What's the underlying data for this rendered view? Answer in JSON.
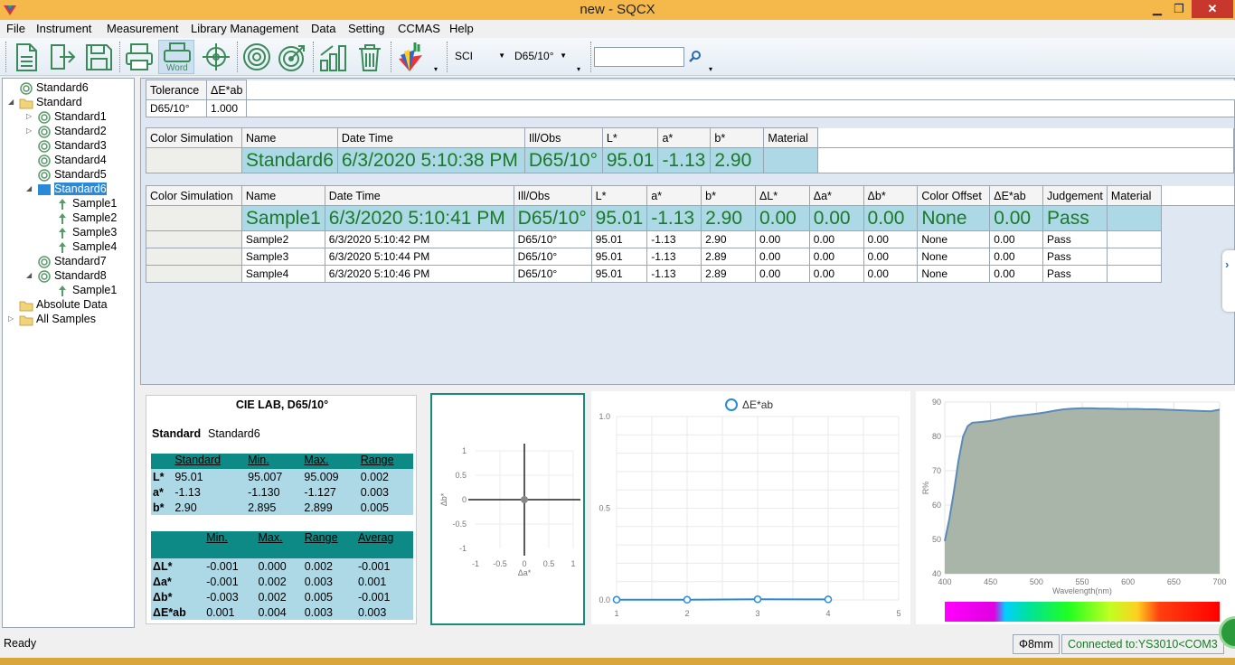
{
  "window": {
    "title": "new - SQCX",
    "minimize": "▁",
    "restore": "❐",
    "close": "✕"
  },
  "menu": [
    "File",
    "Instrument",
    "Measurement",
    "Library Management",
    "Data",
    "Setting",
    "CCMAS",
    "Help"
  ],
  "toolbar": {
    "word_label": "Word",
    "mode": "SCI",
    "illuminant": "D65/10°",
    "search_value": ""
  },
  "tree": {
    "items": [
      {
        "label": "Standard6"
      },
      {
        "label": "Standard"
      },
      {
        "label": "Standard1"
      },
      {
        "label": "Standard2"
      },
      {
        "label": "Standard3"
      },
      {
        "label": "Standard4"
      },
      {
        "label": "Standard5"
      },
      {
        "label": "Standard6"
      },
      {
        "label": "Sample1"
      },
      {
        "label": "Sample2"
      },
      {
        "label": "Sample3"
      },
      {
        "label": "Sample4"
      },
      {
        "label": "Standard7"
      },
      {
        "label": "Standard8"
      },
      {
        "label": "Sample1"
      },
      {
        "label": "Absolute Data"
      },
      {
        "label": "All Samples"
      }
    ]
  },
  "tolerance": {
    "headers": [
      "Tolerance",
      "ΔE*ab"
    ],
    "row": [
      "D65/10°",
      "1.000"
    ]
  },
  "standard_table": {
    "headers": [
      "Color Simulation",
      "Name",
      "Date Time",
      "Ill/Obs",
      "L*",
      "a*",
      "b*",
      "Material"
    ],
    "row": [
      "",
      "Standard6",
      "6/3/2020 5:10:38 PM",
      "D65/10°",
      "95.01",
      "-1.13",
      "2.90",
      ""
    ]
  },
  "sample_table": {
    "headers": [
      "Color Simulation",
      "Name",
      "Date Time",
      "Ill/Obs",
      "L*",
      "a*",
      "b*",
      "ΔL*",
      "Δa*",
      "Δb*",
      "Color Offset",
      "ΔE*ab",
      "Judgement",
      "Material"
    ],
    "rows": [
      [
        "",
        "Sample1",
        "6/3/2020 5:10:41 PM",
        "D65/10°",
        "95.01",
        "-1.13",
        "2.90",
        "0.00",
        "0.00",
        "0.00",
        "None",
        "0.00",
        "Pass",
        ""
      ],
      [
        "",
        "Sample2",
        "6/3/2020 5:10:42 PM",
        "D65/10°",
        "95.01",
        "-1.13",
        "2.90",
        "0.00",
        "0.00",
        "0.00",
        "None",
        "0.00",
        "Pass",
        ""
      ],
      [
        "",
        "Sample3",
        "6/3/2020 5:10:44 PM",
        "D65/10°",
        "95.01",
        "-1.13",
        "2.89",
        "0.00",
        "0.00",
        "0.00",
        "None",
        "0.00",
        "Pass",
        ""
      ],
      [
        "",
        "Sample4",
        "6/3/2020 5:10:46 PM",
        "D65/10°",
        "95.01",
        "-1.13",
        "2.89",
        "0.00",
        "0.00",
        "0.00",
        "None",
        "0.00",
        "Pass",
        ""
      ]
    ]
  },
  "lab_panel": {
    "title": "CIE LAB, D65/10°",
    "standard_label": "Standard",
    "standard_value": "Standard6",
    "t1_headers": [
      "",
      "Standard",
      "Min.",
      "Max.",
      "Range"
    ],
    "t1_rows": [
      [
        "L*",
        "95.01",
        "95.007",
        "95.009",
        "0.002"
      ],
      [
        "a*",
        "-1.13",
        "-1.130",
        "-1.127",
        "0.003"
      ],
      [
        "b*",
        "2.90",
        "2.895",
        "2.899",
        "0.005"
      ]
    ],
    "t2_headers": [
      "",
      "Min.",
      "Max.",
      "Range",
      "Averag"
    ],
    "t2_rows": [
      [
        "ΔL*",
        "-0.001",
        "0.000",
        "0.002",
        "-0.001"
      ],
      [
        "Δa*",
        "-0.001",
        "0.002",
        "0.003",
        "0.001"
      ],
      [
        "Δb*",
        "-0.003",
        "0.002",
        "0.005",
        "-0.001"
      ],
      [
        "ΔE*ab",
        "0.001",
        "0.004",
        "0.003",
        "0.003"
      ]
    ]
  },
  "chart_data": [
    {
      "type": "scatter",
      "xlabel": "Δa*",
      "ylabel": "Δb*",
      "xlim": [
        -1,
        1
      ],
      "ylim": [
        -1,
        1
      ],
      "x_ticks": [
        "-1",
        "-0.5",
        "0",
        "0.5",
        "1"
      ],
      "y_ticks": [
        "1",
        "0.5",
        "0",
        "-0.5",
        "-1"
      ],
      "points": [
        {
          "x": 0,
          "y": 0
        }
      ]
    },
    {
      "type": "line",
      "legend": "ΔE*ab",
      "x": [
        1,
        2,
        3,
        4
      ],
      "values": [
        0.001,
        0.001,
        0.004,
        0.003
      ],
      "xlim": [
        1,
        5
      ],
      "ylim": [
        0,
        1
      ],
      "x_ticks": [
        "1",
        "2",
        "3",
        "4",
        "5"
      ],
      "y_ticks": [
        "1.0",
        "0.5",
        "0.0"
      ],
      "grid": true
    },
    {
      "type": "area",
      "xlabel": "Wavelength(nm)",
      "ylabel": "R%",
      "xlim": [
        400,
        700
      ],
      "ylim": [
        40,
        90
      ],
      "x_ticks": [
        "400",
        "450",
        "500",
        "550",
        "600",
        "650",
        "700"
      ],
      "y_ticks": [
        "90",
        "80",
        "70",
        "60",
        "50",
        "40"
      ],
      "x": [
        400,
        405,
        410,
        415,
        420,
        425,
        430,
        440,
        450,
        460,
        470,
        480,
        490,
        500,
        510,
        520,
        530,
        540,
        550,
        560,
        570,
        580,
        590,
        600,
        610,
        620,
        630,
        640,
        650,
        660,
        670,
        680,
        690,
        700
      ],
      "values": [
        49.5,
        56,
        64,
        73,
        80,
        83,
        84,
        84.2,
        84.5,
        85,
        85.6,
        86,
        86.3,
        86.6,
        87,
        87.5,
        87.9,
        88.1,
        88.2,
        88.2,
        88.1,
        88.1,
        88.0,
        88.0,
        88.0,
        87.9,
        87.9,
        87.8,
        87.7,
        87.6,
        87.5,
        87.4,
        87.3,
        87.8
      ],
      "color": "#a8b5a8"
    }
  ],
  "status": {
    "left": "Ready",
    "aperture": "Φ8mm",
    "connection": "Connected to:YS3010<COM3"
  }
}
